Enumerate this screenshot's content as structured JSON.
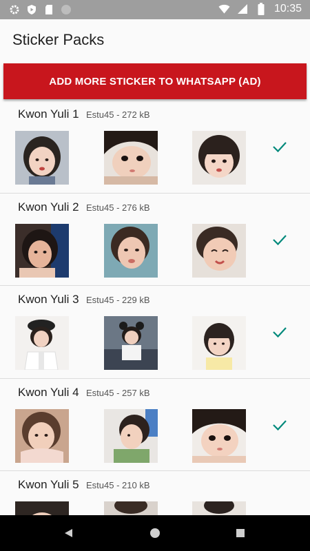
{
  "status_bar": {
    "time": "10:35",
    "icons_left": [
      "gear-icon",
      "shield-play-icon",
      "sd-card-icon",
      "circle-icon"
    ],
    "icons_right": [
      "wifi-icon",
      "signal-icon",
      "battery-icon"
    ]
  },
  "app_bar": {
    "title": "Sticker Packs"
  },
  "ad_button": {
    "label": "ADD MORE STICKER TO WHATSAPP (AD)",
    "color": "#c8161d"
  },
  "packs": [
    {
      "name": "Kwon Yuli 1",
      "meta": "Estu45 - 272 kB",
      "added": true
    },
    {
      "name": "Kwon Yuli 2",
      "meta": "Estu45 - 276 kB",
      "added": true
    },
    {
      "name": "Kwon Yuli 3",
      "meta": "Estu45 - 229 kB",
      "added": true
    },
    {
      "name": "Kwon Yuli 4",
      "meta": "Estu45 - 257 kB",
      "added": true
    },
    {
      "name": "Kwon Yuli 5",
      "meta": "Estu45 - 210 kB",
      "added": false
    }
  ],
  "colors": {
    "accent_check": "#00897b",
    "status_bar": "#9e9e9e"
  },
  "nav_bar": {
    "icons": [
      "back-triangle-icon",
      "home-circle-icon",
      "recents-square-icon"
    ]
  }
}
